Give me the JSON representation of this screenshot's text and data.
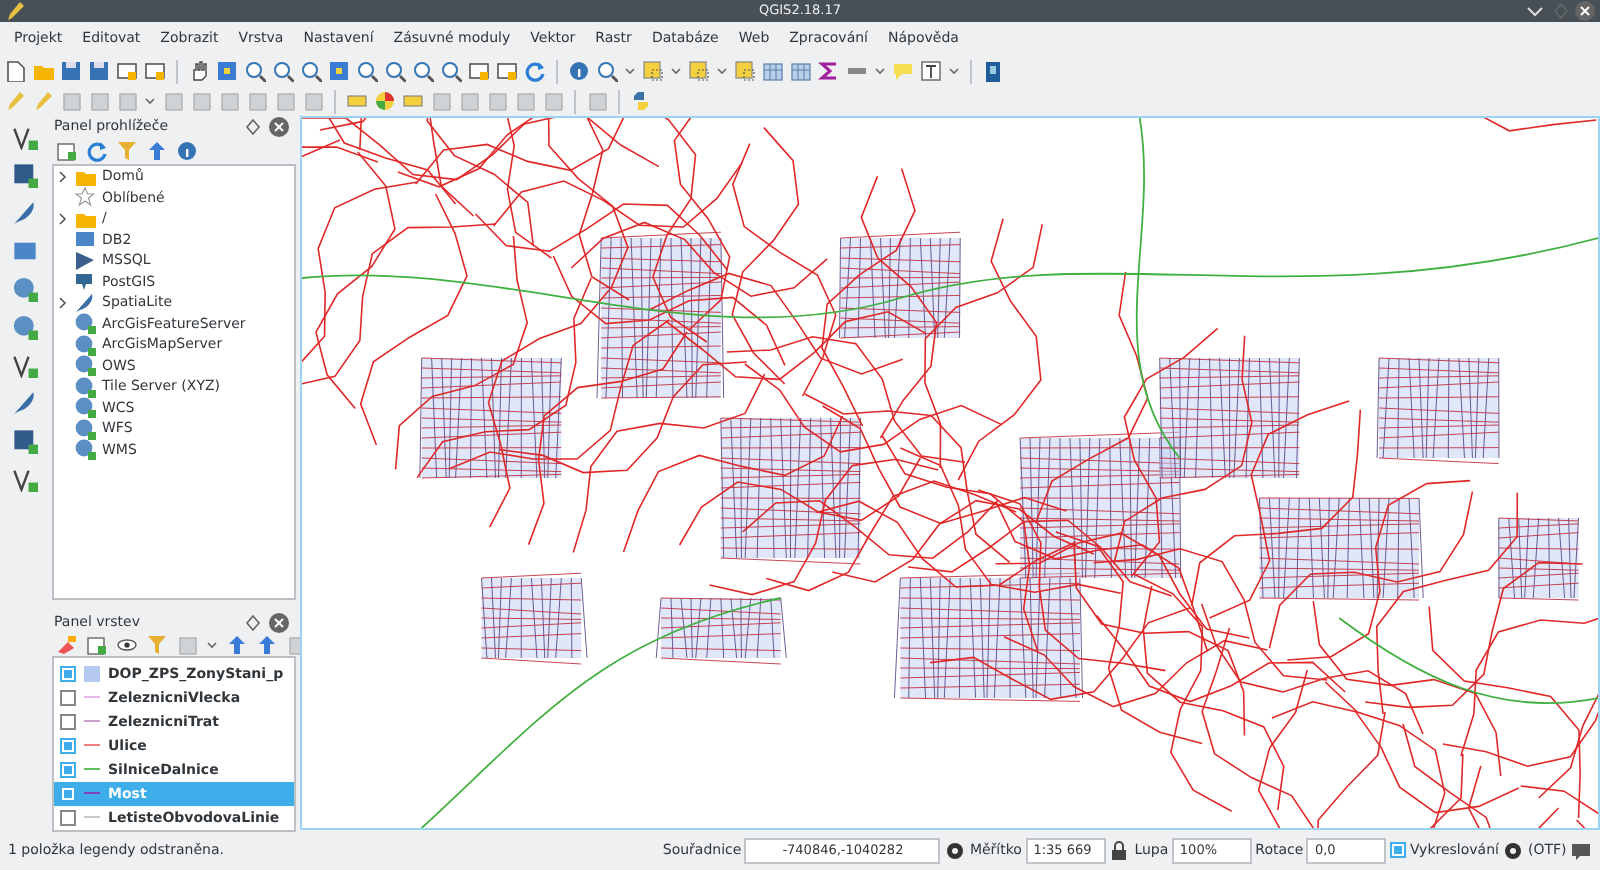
{
  "window": {
    "title": "QGIS2.18.17"
  },
  "menu": [
    "Projekt",
    "Editovat",
    "Zobrazit",
    "Vrstva",
    "Nastavení",
    "Zásuvné moduly",
    "Vektor",
    "Rastr",
    "Databáze",
    "Web",
    "Zpracování",
    "Nápověda"
  ],
  "browser_panel": {
    "title": "Panel prohlížeče",
    "items": [
      {
        "label": "Domů",
        "expandable": true
      },
      {
        "label": "Oblíbené",
        "expandable": false
      },
      {
        "label": "/",
        "expandable": true
      },
      {
        "label": "DB2",
        "expandable": false
      },
      {
        "label": "MSSQL",
        "expandable": false
      },
      {
        "label": "PostGIS",
        "expandable": false
      },
      {
        "label": "SpatiaLite",
        "expandable": true
      },
      {
        "label": "ArcGisFeatureServer",
        "expandable": false
      },
      {
        "label": "ArcGisMapServer",
        "expandable": false
      },
      {
        "label": "OWS",
        "expandable": false
      },
      {
        "label": "Tile Server (XYZ)",
        "expandable": false
      },
      {
        "label": "WCS",
        "expandable": false
      },
      {
        "label": "WFS",
        "expandable": false
      },
      {
        "label": "WMS",
        "expandable": false
      }
    ]
  },
  "layers_panel": {
    "title": "Panel vrstev",
    "layers": [
      {
        "name": "DOP_ZPS_ZonyStani_p",
        "kind": "polygon",
        "color": "#b4c8f0",
        "checked": true,
        "selected": false
      },
      {
        "name": "ZeleznicniVlecka",
        "kind": "line",
        "color": "#e8b8e8",
        "checked": false,
        "selected": false
      },
      {
        "name": "ZeleznicniTrat",
        "kind": "line",
        "color": "#c8a0c8",
        "checked": false,
        "selected": false
      },
      {
        "name": "Ulice",
        "kind": "line",
        "color": "#f08080",
        "checked": true,
        "selected": false
      },
      {
        "name": "SilniceDalnice",
        "kind": "line",
        "color": "#60c060",
        "checked": true,
        "selected": false
      },
      {
        "name": "Most",
        "kind": "line",
        "color": "#8040c0",
        "checked": true,
        "selected": true
      },
      {
        "name": "LetisteObvodovaLinie",
        "kind": "line",
        "color": "#c8c8c8",
        "checked": false,
        "selected": false
      }
    ]
  },
  "status_bar": {
    "message": "1 položka legendy odstraněna.",
    "coordinate_label": "Souřadnice",
    "coordinate": "-740846,-1040282",
    "scale_label": "Měřítko",
    "scale": "1:35 669",
    "magnifier_label": "Lupa",
    "magnifier": "100%",
    "rotation_label": "Rotace",
    "rotation": "0,0",
    "render_label": "Vykreslování",
    "render_checked": true,
    "crs": "(OTF)"
  }
}
